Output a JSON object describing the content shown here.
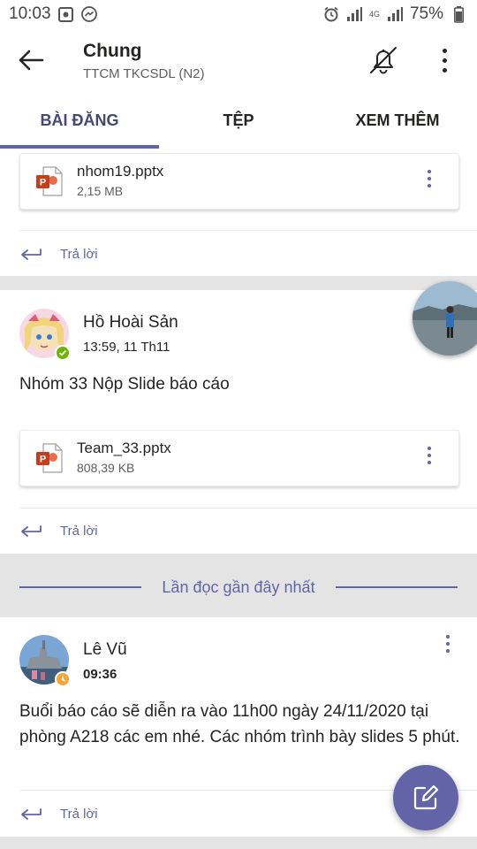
{
  "status_bar": {
    "time": "10:03",
    "battery": "75%",
    "network": "4G",
    "icons": [
      "image-notification-icon",
      "messenger-icon",
      "alarm-icon",
      "signal-icon",
      "battery-icon"
    ]
  },
  "header": {
    "title": "Chung",
    "subtitle": "TTCM TKCSDL (N2)",
    "icons": [
      "back-arrow-icon",
      "bell-muted-icon",
      "more-vertical-icon"
    ]
  },
  "tabs": [
    {
      "label": "BÀI ĐĂNG",
      "active": true
    },
    {
      "label": "TỆP",
      "active": false
    },
    {
      "label": "XEM THÊM",
      "active": false
    }
  ],
  "posts": [
    {
      "attachment": {
        "name": "nhom19.pptx",
        "size": "2,15 MB",
        "icon": "powerpoint-icon"
      },
      "reply_label": "Trả lời"
    },
    {
      "author": "Hồ Hoài Sản",
      "time": "13:59, 11 Th11",
      "message": "Nhóm 33 Nộp Slide báo cáo",
      "presence": "available",
      "attachment": {
        "name": "Team_33.pptx",
        "size": "808,39 KB",
        "icon": "powerpoint-icon"
      },
      "reply_label": "Trả lời"
    },
    {
      "author": "Lê Vũ",
      "time": "09:36",
      "message": "Buổi báo cáo sẽ diễn ra vào 11h00 ngày 24/11/2020 tại phòng A218 các em nhé. Các nhóm trình bày slides 5 phút.",
      "presence": "away",
      "reply_label": "Trả lời"
    }
  ],
  "last_read_label": "Lần đọc gần đây nhất",
  "fab": {
    "icon": "compose-icon"
  },
  "colors": {
    "accent": "#6264a7",
    "available": "#6bb700",
    "away": "#f8a535",
    "powerpoint": "#c43e1c"
  }
}
